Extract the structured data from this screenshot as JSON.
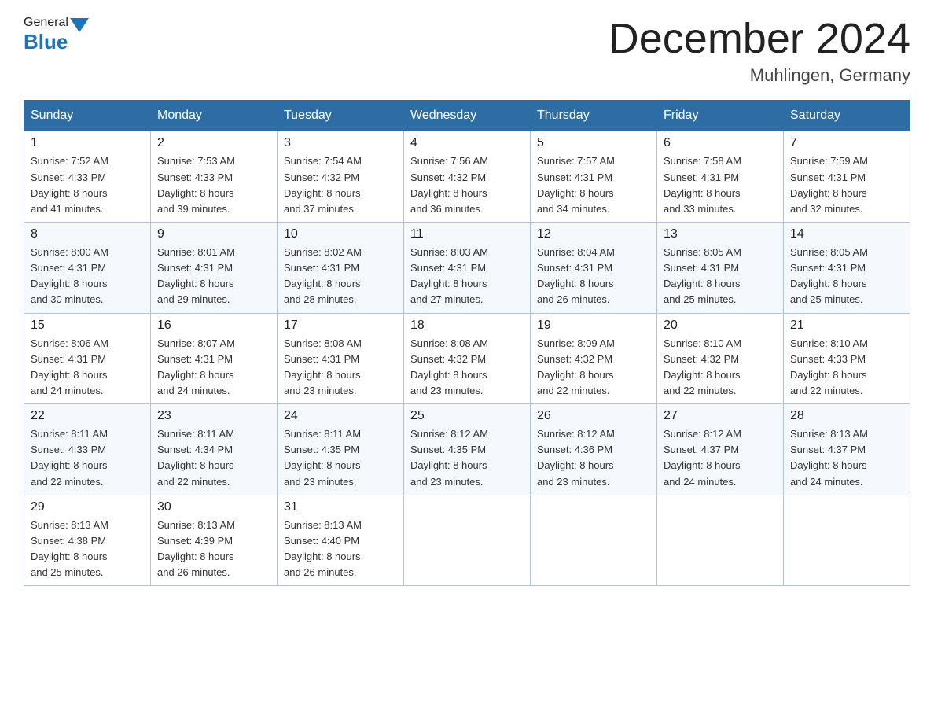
{
  "header": {
    "logo_general": "General",
    "logo_blue": "Blue",
    "month_title": "December 2024",
    "location": "Muhlingen, Germany"
  },
  "days_of_week": [
    "Sunday",
    "Monday",
    "Tuesday",
    "Wednesday",
    "Thursday",
    "Friday",
    "Saturday"
  ],
  "weeks": [
    [
      {
        "day": "1",
        "sunrise": "7:52 AM",
        "sunset": "4:33 PM",
        "daylight": "8 hours and 41 minutes."
      },
      {
        "day": "2",
        "sunrise": "7:53 AM",
        "sunset": "4:33 PM",
        "daylight": "8 hours and 39 minutes."
      },
      {
        "day": "3",
        "sunrise": "7:54 AM",
        "sunset": "4:32 PM",
        "daylight": "8 hours and 37 minutes."
      },
      {
        "day": "4",
        "sunrise": "7:56 AM",
        "sunset": "4:32 PM",
        "daylight": "8 hours and 36 minutes."
      },
      {
        "day": "5",
        "sunrise": "7:57 AM",
        "sunset": "4:31 PM",
        "daylight": "8 hours and 34 minutes."
      },
      {
        "day": "6",
        "sunrise": "7:58 AM",
        "sunset": "4:31 PM",
        "daylight": "8 hours and 33 minutes."
      },
      {
        "day": "7",
        "sunrise": "7:59 AM",
        "sunset": "4:31 PM",
        "daylight": "8 hours and 32 minutes."
      }
    ],
    [
      {
        "day": "8",
        "sunrise": "8:00 AM",
        "sunset": "4:31 PM",
        "daylight": "8 hours and 30 minutes."
      },
      {
        "day": "9",
        "sunrise": "8:01 AM",
        "sunset": "4:31 PM",
        "daylight": "8 hours and 29 minutes."
      },
      {
        "day": "10",
        "sunrise": "8:02 AM",
        "sunset": "4:31 PM",
        "daylight": "8 hours and 28 minutes."
      },
      {
        "day": "11",
        "sunrise": "8:03 AM",
        "sunset": "4:31 PM",
        "daylight": "8 hours and 27 minutes."
      },
      {
        "day": "12",
        "sunrise": "8:04 AM",
        "sunset": "4:31 PM",
        "daylight": "8 hours and 26 minutes."
      },
      {
        "day": "13",
        "sunrise": "8:05 AM",
        "sunset": "4:31 PM",
        "daylight": "8 hours and 25 minutes."
      },
      {
        "day": "14",
        "sunrise": "8:05 AM",
        "sunset": "4:31 PM",
        "daylight": "8 hours and 25 minutes."
      }
    ],
    [
      {
        "day": "15",
        "sunrise": "8:06 AM",
        "sunset": "4:31 PM",
        "daylight": "8 hours and 24 minutes."
      },
      {
        "day": "16",
        "sunrise": "8:07 AM",
        "sunset": "4:31 PM",
        "daylight": "8 hours and 24 minutes."
      },
      {
        "day": "17",
        "sunrise": "8:08 AM",
        "sunset": "4:31 PM",
        "daylight": "8 hours and 23 minutes."
      },
      {
        "day": "18",
        "sunrise": "8:08 AM",
        "sunset": "4:32 PM",
        "daylight": "8 hours and 23 minutes."
      },
      {
        "day": "19",
        "sunrise": "8:09 AM",
        "sunset": "4:32 PM",
        "daylight": "8 hours and 22 minutes."
      },
      {
        "day": "20",
        "sunrise": "8:10 AM",
        "sunset": "4:32 PM",
        "daylight": "8 hours and 22 minutes."
      },
      {
        "day": "21",
        "sunrise": "8:10 AM",
        "sunset": "4:33 PM",
        "daylight": "8 hours and 22 minutes."
      }
    ],
    [
      {
        "day": "22",
        "sunrise": "8:11 AM",
        "sunset": "4:33 PM",
        "daylight": "8 hours and 22 minutes."
      },
      {
        "day": "23",
        "sunrise": "8:11 AM",
        "sunset": "4:34 PM",
        "daylight": "8 hours and 22 minutes."
      },
      {
        "day": "24",
        "sunrise": "8:11 AM",
        "sunset": "4:35 PM",
        "daylight": "8 hours and 23 minutes."
      },
      {
        "day": "25",
        "sunrise": "8:12 AM",
        "sunset": "4:35 PM",
        "daylight": "8 hours and 23 minutes."
      },
      {
        "day": "26",
        "sunrise": "8:12 AM",
        "sunset": "4:36 PM",
        "daylight": "8 hours and 23 minutes."
      },
      {
        "day": "27",
        "sunrise": "8:12 AM",
        "sunset": "4:37 PM",
        "daylight": "8 hours and 24 minutes."
      },
      {
        "day": "28",
        "sunrise": "8:13 AM",
        "sunset": "4:37 PM",
        "daylight": "8 hours and 24 minutes."
      }
    ],
    [
      {
        "day": "29",
        "sunrise": "8:13 AM",
        "sunset": "4:38 PM",
        "daylight": "8 hours and 25 minutes."
      },
      {
        "day": "30",
        "sunrise": "8:13 AM",
        "sunset": "4:39 PM",
        "daylight": "8 hours and 26 minutes."
      },
      {
        "day": "31",
        "sunrise": "8:13 AM",
        "sunset": "4:40 PM",
        "daylight": "8 hours and 26 minutes."
      },
      null,
      null,
      null,
      null
    ]
  ],
  "labels": {
    "sunrise": "Sunrise:",
    "sunset": "Sunset:",
    "daylight": "Daylight:"
  },
  "colors": {
    "header_bg": "#2e6da4",
    "logo_blue": "#1a75bb",
    "triangle_blue": "#1a75bb"
  }
}
